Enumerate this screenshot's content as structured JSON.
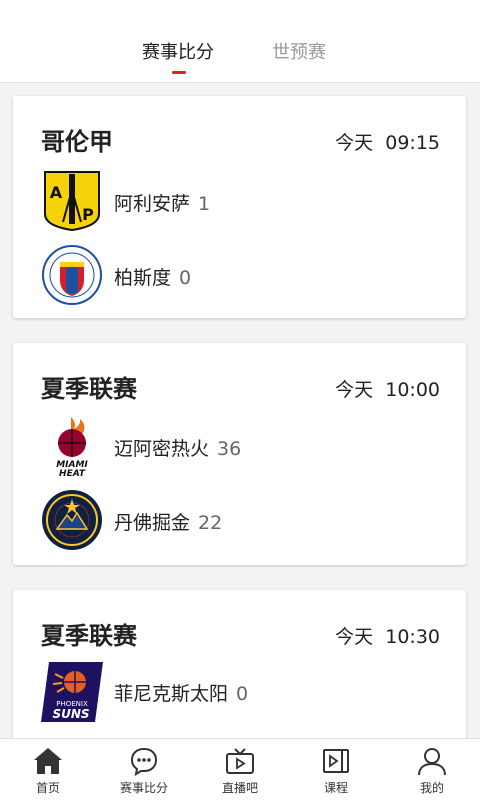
{
  "tabs": [
    "赛事比分",
    "世预赛"
  ],
  "matches": [
    {
      "league": "哥伦甲",
      "time": "今天  09:15",
      "home": {
        "name": "阿利安萨",
        "score": "1"
      },
      "away": {
        "name": "柏斯度",
        "score": "0"
      }
    },
    {
      "league": "夏季联赛",
      "time": "今天  10:00",
      "home": {
        "name": "迈阿密热火",
        "score": "36"
      },
      "away": {
        "name": "丹佛掘金",
        "score": "22"
      }
    },
    {
      "league": "夏季联赛",
      "time": "今天  10:30",
      "home": {
        "name": "菲尼克斯太阳",
        "score": "0"
      }
    }
  ],
  "nav": [
    {
      "label": "首页",
      "icon": "home-icon"
    },
    {
      "label": "赛事比分",
      "icon": "chat-icon"
    },
    {
      "label": "直播吧",
      "icon": "tv-icon"
    },
    {
      "label": "课程",
      "icon": "video-icon"
    },
    {
      "label": "我的",
      "icon": "user-icon"
    }
  ],
  "colors": {
    "accent": "#e02020"
  }
}
